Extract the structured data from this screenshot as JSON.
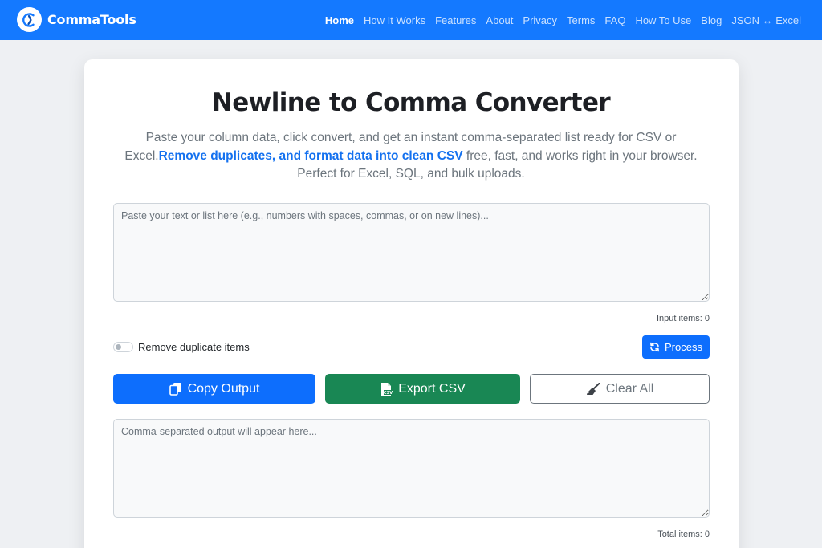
{
  "nav": {
    "brand": "CommaTools",
    "links": [
      "Home",
      "How It Works",
      "Features",
      "About",
      "Privacy",
      "Terms",
      "FAQ",
      "How To Use",
      "Blog",
      "JSON ↔ Excel"
    ],
    "active": "Home"
  },
  "hero": {
    "title": "Newline to Comma Converter",
    "desc_part1": "Paste your column data, click convert, and get an instant comma-separated list ready for CSV or Excel.",
    "desc_highlight": "Remove duplicates, and format data into clean CSV",
    "desc_part2": " free, fast, and works right in your browser. Perfect for Excel, SQL, and bulk uploads."
  },
  "input": {
    "placeholder": "Paste your text or list here (e.g., numbers with spaces, commas, or on new lines)...",
    "value": "",
    "count_label": "Input items: 0"
  },
  "options": {
    "remove_duplicates_label": "Remove duplicate items",
    "remove_duplicates_checked": false,
    "process_label": "Process"
  },
  "actions": {
    "copy_label": "Copy Output",
    "export_label": "Export CSV",
    "clear_label": "Clear All"
  },
  "output": {
    "placeholder": "Comma-separated output will appear here...",
    "value": "",
    "count_label": "Total items: 0"
  },
  "icons": {
    "logo": "commatools-logo-icon",
    "process": "sync-icon",
    "copy": "copy-icon",
    "export": "csv-file-icon",
    "clear": "broom-icon"
  },
  "colors": {
    "navbar": "#1479ff",
    "primary": "#0d6efd",
    "success": "#198754",
    "highlight": "#1471ef",
    "secondary": "#6c757d"
  }
}
